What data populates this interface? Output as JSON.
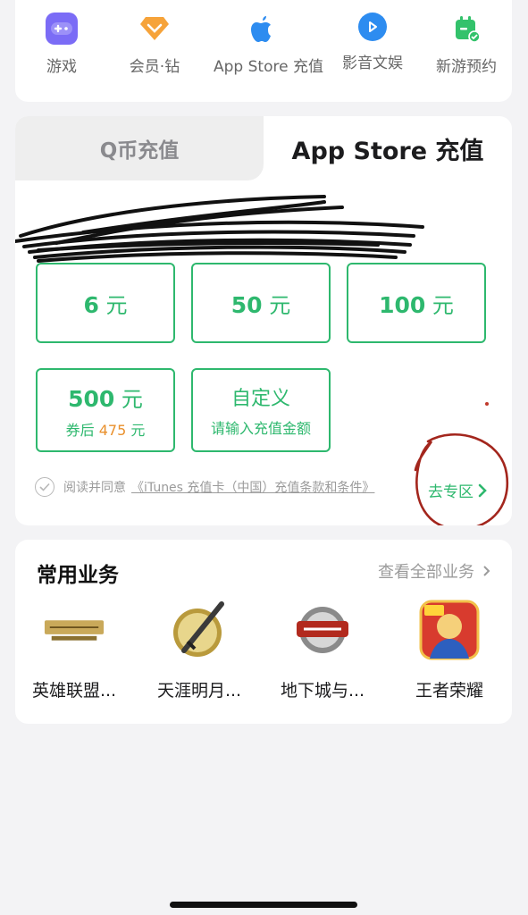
{
  "quick_services": [
    {
      "label": "游戏",
      "icon": "gamepad-icon",
      "color": "#7b6cf6"
    },
    {
      "label": "会员·钻",
      "icon": "diamond-icon",
      "color": "#f6a33a"
    },
    {
      "label": "App Store 充值",
      "icon": "apple-icon",
      "color": "#2d8cf0"
    },
    {
      "label": "影音文娱",
      "icon": "play-icon",
      "color": "#2d8cf0"
    },
    {
      "label": "新游预约",
      "icon": "calendar-icon",
      "color": "#33c26b"
    }
  ],
  "recharge": {
    "tabs": [
      {
        "label": "Q币充值",
        "active": false
      },
      {
        "label": "App Store 充值",
        "active": true
      }
    ],
    "options": [
      {
        "amount": "6",
        "unit": "元"
      },
      {
        "amount": "50",
        "unit": "元"
      },
      {
        "amount": "100",
        "unit": "元"
      },
      {
        "amount": "500",
        "unit": "元",
        "sub_prefix": "券后",
        "sub_amount": "475",
        "sub_unit": "元"
      },
      {
        "title": "自定义",
        "subtitle": "请输入充值金额"
      }
    ],
    "agree_text": "阅读并同意",
    "terms_text": "《iTunes 充值卡（中国）充值条款和条件》",
    "goto_label": "去专区",
    "accent_color": "#2eb86e",
    "annotation_color": "#a3261d"
  },
  "common": {
    "title": "常用业务",
    "view_all": "查看全部业务",
    "games": [
      {
        "name": "英雄联盟...",
        "icon": "league-of-legends-icon"
      },
      {
        "name": "天涯明月...",
        "icon": "moonlight-blade-icon"
      },
      {
        "name": "地下城与...",
        "icon": "dnf-icon"
      },
      {
        "name": "王者荣耀",
        "icon": "honor-of-kings-icon"
      }
    ]
  }
}
